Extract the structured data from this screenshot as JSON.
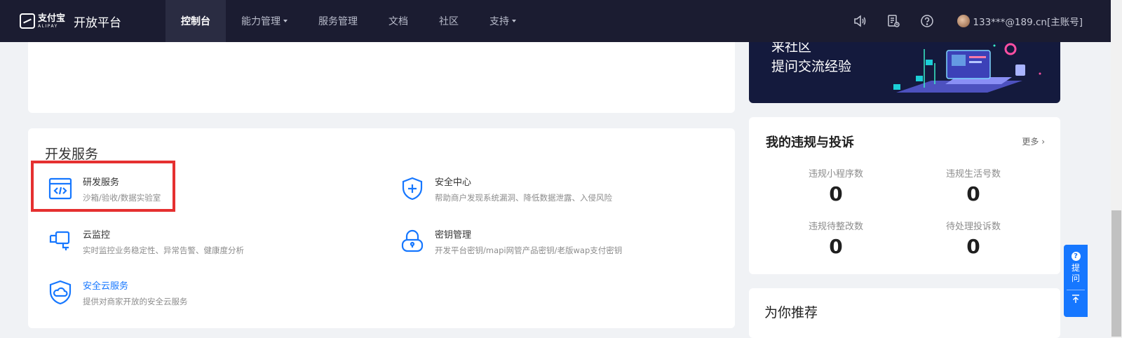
{
  "header": {
    "logo_cn": "支付宝",
    "logo_en": "ALIPAY",
    "platform_title": "开放平台",
    "nav": [
      {
        "label": "控制台",
        "active": true,
        "dropdown": false
      },
      {
        "label": "能力管理",
        "active": false,
        "dropdown": true
      },
      {
        "label": "服务管理",
        "active": false,
        "dropdown": false
      },
      {
        "label": "文档",
        "active": false,
        "dropdown": false
      },
      {
        "label": "社区",
        "active": false,
        "dropdown": false
      },
      {
        "label": "支持",
        "active": false,
        "dropdown": true
      }
    ],
    "icons": [
      "speaker-icon",
      "notice-list-icon",
      "help-icon"
    ],
    "user": "133***@189.cn[主账号]"
  },
  "dev_services": {
    "title": "开发服务",
    "items": [
      {
        "name": "研发服务",
        "desc": "沙箱/验收/数据实验室",
        "icon": "code-window-icon",
        "highlighted": true
      },
      {
        "name": "安全中心",
        "desc": "帮助商户发现系统漏洞、降低数据泄露、入侵风险",
        "icon": "shield-plus-icon"
      },
      {
        "name": "云监控",
        "desc": "实时监控业务稳定性、异常告警、健康度分析",
        "icon": "monitor-camera-icon"
      },
      {
        "name": "密钥管理",
        "desc": "开发平台密钥/mapi网管产品密钥/老版wap支付密钥",
        "icon": "lock-icon"
      },
      {
        "name": "安全云服务",
        "desc": "提供对商家开放的安全云服务",
        "icon": "shield-cloud-icon",
        "link": true
      }
    ]
  },
  "banner": {
    "line1": "来社区",
    "line2": "提问交流经验"
  },
  "violations": {
    "title": "我的违规与投诉",
    "more": "更多",
    "stats": [
      {
        "label": "违规小程序数",
        "value": "0"
      },
      {
        "label": "违规生活号数",
        "value": "0"
      },
      {
        "label": "违规待整改数",
        "value": "0"
      },
      {
        "label": "待处理投诉数",
        "value": "0"
      }
    ]
  },
  "recommend": {
    "title": "为你推荐"
  },
  "float": {
    "ask_label": "提问"
  },
  "colors": {
    "nav_bg": "#1b1c31",
    "accent": "#1677ff",
    "highlight": "#e53030"
  }
}
